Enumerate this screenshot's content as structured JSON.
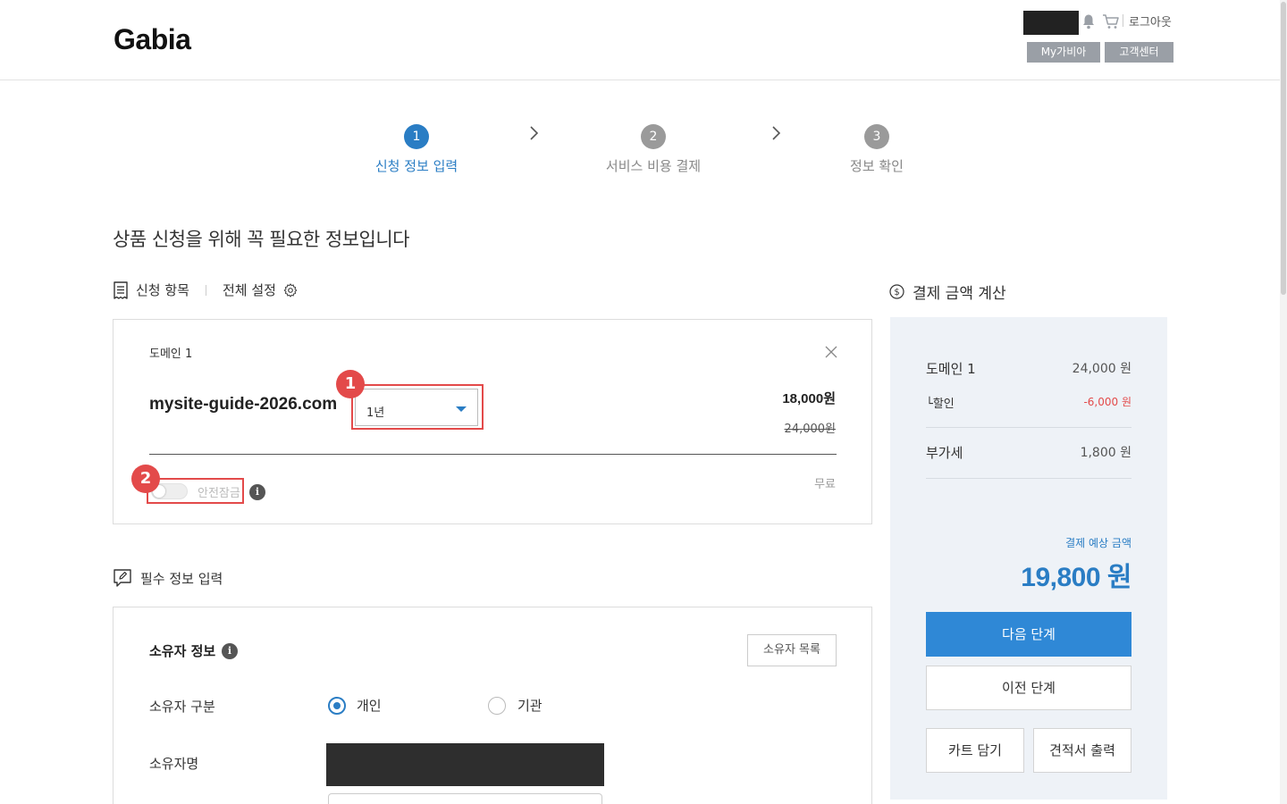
{
  "header": {
    "logo": "Gabia",
    "logout": "로그아웃",
    "my_gabia": "My가비아",
    "customer_center": "고객센터"
  },
  "steps": [
    {
      "num": "1",
      "label": "신청 정보 입력",
      "active": true
    },
    {
      "num": "2",
      "label": "서비스 비용 결제",
      "active": false
    },
    {
      "num": "3",
      "label": "정보 확인",
      "active": false
    }
  ],
  "page_title": "상품 신청을 위해 꼭 필요한 정보입니다",
  "apply_section": {
    "title": "신청 항목",
    "settings": "전체 설정"
  },
  "domain_card": {
    "label": "도메인 1",
    "domain": "mysite-guide-2026.com",
    "period": "1년",
    "price": "18,000원",
    "original_price": "24,000원",
    "safe_lock": "안전잠금",
    "safe_lock_on": false,
    "safe_lock_price": "무료",
    "annotation_1": "1",
    "annotation_2": "2"
  },
  "required_section": {
    "title": "필수 정보 입력"
  },
  "owner": {
    "title": "소유자 정보",
    "list_button": "소유자 목록",
    "type_label": "소유자 구분",
    "type_personal": "개인",
    "type_org": "기관",
    "type_selected": "개인",
    "name_label": "소유자명"
  },
  "payment": {
    "title": "결제 금액 계산",
    "domain_label": "도메인 1",
    "domain_price": "24,000 원",
    "discount_label": "└할인",
    "discount_value": "-6,000 원",
    "vat_label": "부가세",
    "vat_value": "1,800 원",
    "estimated_label": "결제 예상 금액",
    "estimated_amount": "19,800 원",
    "next_button": "다음 단계",
    "prev_button": "이전 단계",
    "cart_button": "카트 담기",
    "quote_button": "견적서 출력"
  },
  "colors": {
    "accent": "#2a7dc4",
    "highlight": "#e34a4a",
    "panel": "#eef2f7"
  }
}
